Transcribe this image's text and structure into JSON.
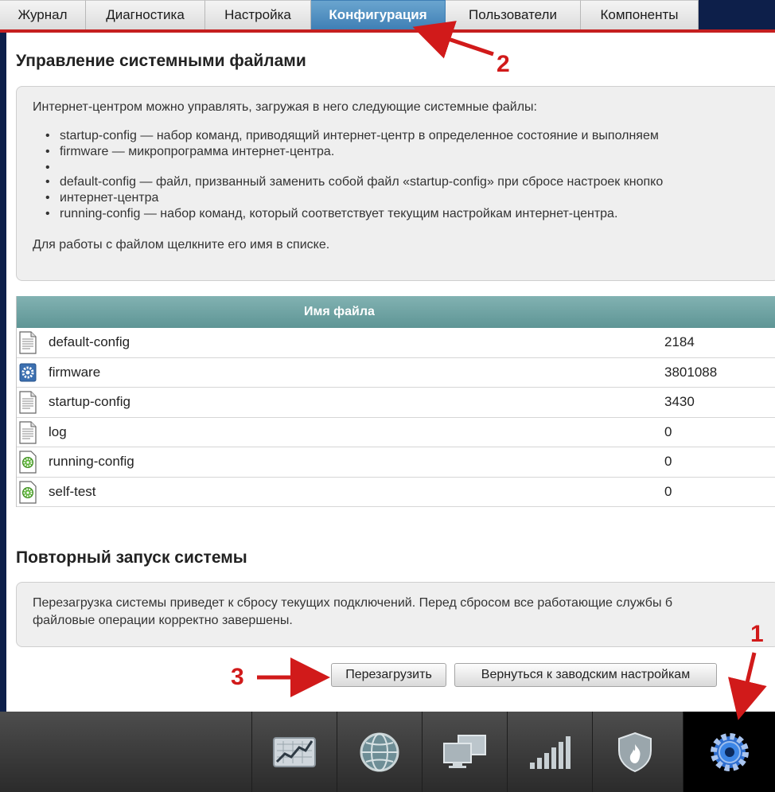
{
  "tabs": [
    {
      "label": "Журнал"
    },
    {
      "label": "Диагностика"
    },
    {
      "label": "Настройка"
    },
    {
      "label": "Конфигурация"
    },
    {
      "label": "Пользователи"
    },
    {
      "label": "Компоненты"
    }
  ],
  "active_tab": "Конфигурация",
  "files_section": {
    "title": "Управление системными файлами",
    "intro": "Интернет-центром можно управлять, загружая в него следующие системные файлы:",
    "bullets": [
      "startup-config — набор команд, приводящий интернет-центр в определенное состояние и выполняем",
      "firmware — микропрограмма интернет-центра.",
      "default-config — файл, призванный заменить собой файл «startup-config» при сбросе настроек кнопко",
      "интернет-центра",
      "running-config — набор команд, который соответствует текущим настройкам интернет-центра."
    ],
    "outro": "Для работы с файлом щелкните его имя в списке."
  },
  "table": {
    "header": "Имя файла",
    "rows": [
      {
        "name": "default-config",
        "size": "2184",
        "icon": "document-icon"
      },
      {
        "name": "firmware",
        "size": "3801088",
        "icon": "gear-file-icon"
      },
      {
        "name": "startup-config",
        "size": "3430",
        "icon": "document-icon"
      },
      {
        "name": "log",
        "size": "0",
        "icon": "document-icon"
      },
      {
        "name": "running-config",
        "size": "0",
        "icon": "green-gear-document-icon"
      },
      {
        "name": "self-test",
        "size": "0",
        "icon": "green-gear-document-icon"
      }
    ]
  },
  "restart_section": {
    "title": "Повторный запуск системы",
    "text_line1": "Перезагрузка системы приведет к сбросу текущих подключений. Перед сбросом все работающие службы б",
    "text_line2": "файловые операции корректно завершены."
  },
  "buttons": {
    "reboot": "Перезагрузить",
    "factory_reset": "Вернуться к заводским настройкам"
  },
  "bottom_nav": [
    {
      "icon": "monitoring-chart-icon"
    },
    {
      "icon": "globe-internet-icon"
    },
    {
      "icon": "home-network-computers-icon"
    },
    {
      "icon": "wifi-signal-bars-icon"
    },
    {
      "icon": "security-shield-icon"
    },
    {
      "icon": "system-gear-icon",
      "active": true
    }
  ],
  "annotations": {
    "a1": "1",
    "a2": "2",
    "a3": "3",
    "color": "#d11a1a"
  },
  "colors": {
    "tab_active": "#4a8bc0",
    "accent_red": "#c51f1f",
    "frame_navy": "#0d1f4a",
    "table_header": "#6fa3a3"
  }
}
